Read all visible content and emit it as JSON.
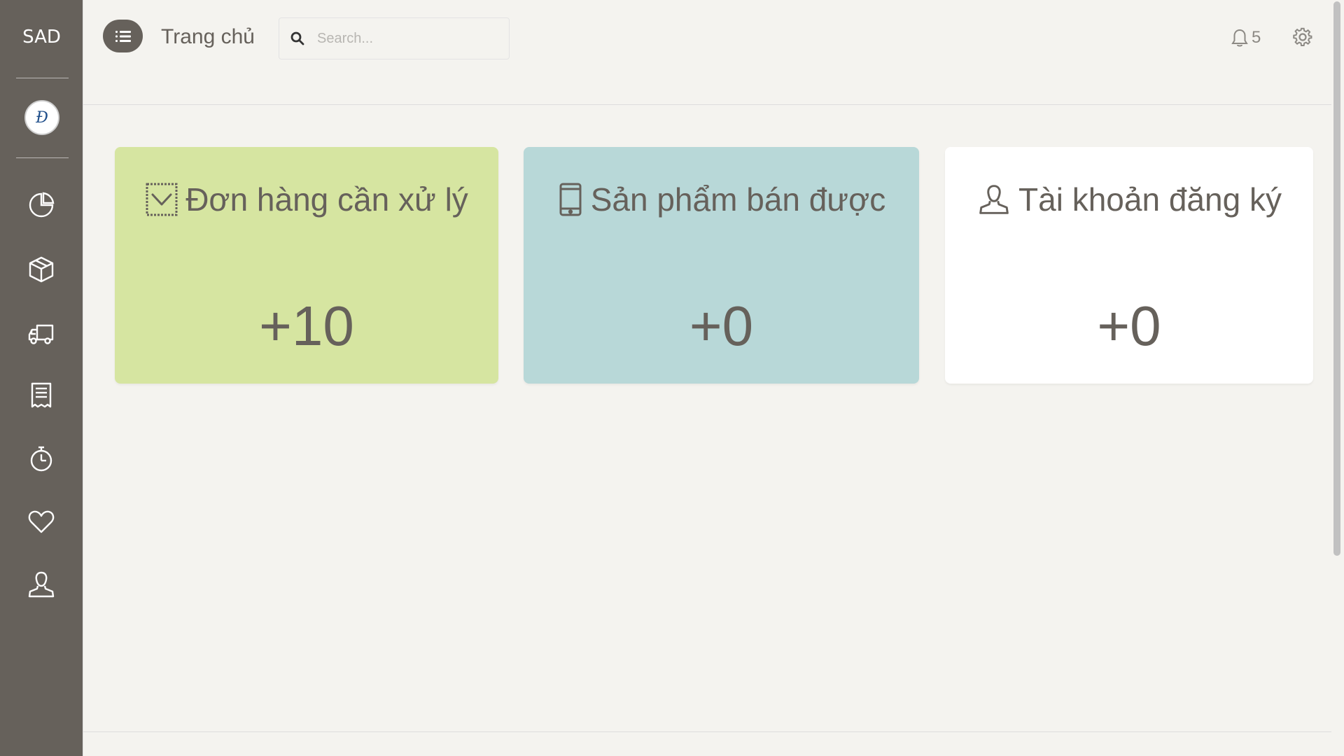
{
  "sidebar": {
    "brand": "SAD",
    "logo_letter": "Đ",
    "items": [
      {
        "icon": "pie-chart-icon"
      },
      {
        "icon": "box-icon"
      },
      {
        "icon": "truck-icon"
      },
      {
        "icon": "receipt-icon"
      },
      {
        "icon": "stopwatch-icon"
      },
      {
        "icon": "heart-icon"
      },
      {
        "icon": "user-icon"
      }
    ]
  },
  "header": {
    "title": "Trang chủ",
    "search_placeholder": "Search...",
    "notification_count": "5"
  },
  "cards": [
    {
      "title": "Đơn hàng cần xử lý",
      "value": "+10",
      "color": "#d6e5a1",
      "icon": "checkbox-icon"
    },
    {
      "title": "Sản phẩm bán được",
      "value": "+0",
      "color": "#b8d8d8",
      "icon": "mobile-icon"
    },
    {
      "title": "Tài khoản đăng ký",
      "value": "+0",
      "color": "#ffffff",
      "icon": "user-icon"
    }
  ],
  "colors": {
    "sidebar": "#66615b",
    "background": "#f4f3ef",
    "text": "#66615b"
  }
}
